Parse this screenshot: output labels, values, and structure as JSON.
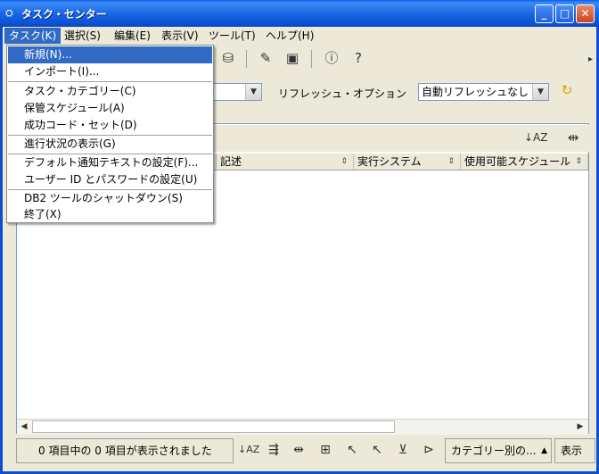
{
  "window": {
    "title": "タスク・センター"
  },
  "titlebar_buttons": {
    "minimize": "_",
    "maximize": "□",
    "close": "✕"
  },
  "menubar": [
    {
      "label": "タスク(K)"
    },
    {
      "label": "選択(S)"
    },
    {
      "label": "編集(E)"
    },
    {
      "label": "表示(V)"
    },
    {
      "label": "ツール(T)"
    },
    {
      "label": "ヘルプ(H)"
    }
  ],
  "dropdown_menu": {
    "items": [
      {
        "label": "新規(N)..."
      },
      {
        "label": "インポート(I)..."
      },
      {
        "label": "タスク・カテゴリー(C)"
      },
      {
        "label": "保管スケジュール(A)"
      },
      {
        "label": "成功コード・セット(D)"
      },
      {
        "label": "進行状況の表示(G)"
      },
      {
        "label": "デフォルト通知テキストの設定(F)..."
      },
      {
        "label": "ユーザー ID とパスワードの設定(U)"
      },
      {
        "label": "DB2 ツールのシャットダウン(S)"
      },
      {
        "label": "終了(X)"
      }
    ]
  },
  "toolbar_icons": [
    "database-icon",
    "task-list-icon",
    "console-icon",
    "info-icon",
    "help-icon"
  ],
  "filter": {
    "refresh_label": "リフレッシュ・オプション",
    "refresh_value": "自動リフレッシュなし",
    "left_combo_value": ""
  },
  "table": {
    "columns": [
      {
        "label": ""
      },
      {
        "label": "記述"
      },
      {
        "label": "実行システム"
      },
      {
        "label": "使用可能スケジュール"
      }
    ]
  },
  "status": {
    "count_text": "0 項目中の 0 項目が表示されました",
    "category_button": "カテゴリー別の...",
    "view_button": "表示"
  }
}
